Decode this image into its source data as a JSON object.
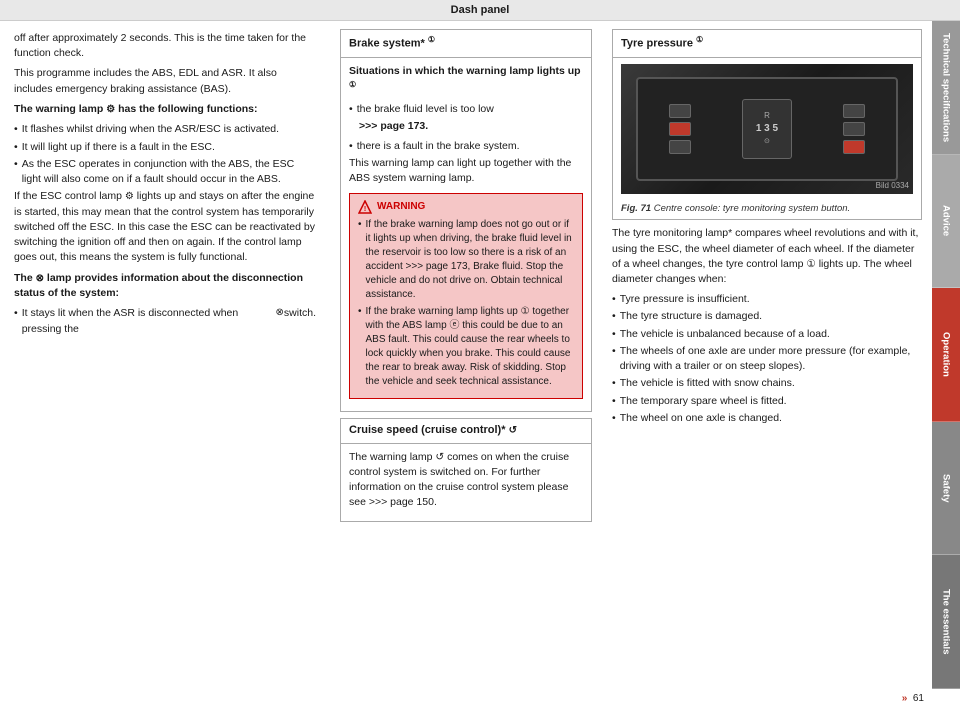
{
  "header": {
    "title": "Dash panel"
  },
  "left_column": {
    "intro_text": "off after approximately 2 seconds. This is the time taken for the function check.",
    "programme_text": "This programme includes the ABS, EDL and ASR. It also includes emergency braking assistance (BAS).",
    "warning_lamp_header": "The warning lamp",
    "warning_lamp_symbol": "⚙",
    "warning_lamp_suffix": " has the following functions:",
    "bullets": [
      "It flashes whilst driving when the ASR/ESC is activated.",
      "It will light up if there is a fault in the ESC.",
      "As the ESC operates in conjunction with the ABS, the ESC light will also come on if a fault should occur in the ABS."
    ],
    "esc_control_text": "If the ESC control lamp",
    "esc_control_symbol": "⚙",
    "esc_control_text2": "lights up and stays on after the engine is started, this may mean that the control system has temporarily switched off the ESC. In this case the ESC can be reactivated by switching the ignition off and then on again. If the control lamp goes out, this means the system is fully functional.",
    "lamp_provides_header": "The",
    "lamp_provides_symbol": "⊗",
    "lamp_provides_text": " lamp provides information about the disconnection status of the system:",
    "stays_lit_bullet": "It stays lit when the ASR is disconnected when pressing the",
    "stays_lit_symbol": "⊗",
    "stays_lit_suffix": " switch."
  },
  "middle_column": {
    "brake_system_header": "Brake system*",
    "brake_icon": "①",
    "situations_header": "Situations in which the warning lamp lights up",
    "situations_icon": "①",
    "bullet1": "the brake fluid level is too low",
    "page_ref1": ">>> page 173.",
    "bullet2": "there is a fault in the brake system.",
    "together_text": "This warning lamp can light up together with the ABS system warning lamp.",
    "warning_title": "WARNING",
    "warning_bullets": [
      "If the brake warning lamp does not go out or if it lights up when driving, the brake fluid level in the reservoir is too low so there is a risk of an accident >>> page 173, Brake fluid. Stop the vehicle and do not drive on. Obtain technical assistance.",
      "If the brake warning lamp lights up ① together with the ABS lamp ⓔ this could be due to an ABS fault. This could cause the rear wheels to lock quickly when you brake. This could cause the rear to break away. Risk of skidding. Stop the vehicle and seek technical assistance."
    ],
    "cruise_header": "Cruise speed (cruise control)*",
    "cruise_icon": "↺",
    "cruise_text": "The warning lamp ↺ comes on when the cruise control system is switched on. For further information on the cruise control system please see >>> page 150."
  },
  "right_column": {
    "tyre_header": "Tyre pressure",
    "tyre_icon": "①",
    "fig_number": "Fig. 71",
    "fig_caption": "Centre console: tyre monitoring system button.",
    "fig_ref": "Bild 0334",
    "intro_text": "The tyre monitoring lamp* compares wheel revolutions and with it, using the ESC, the wheel diameter of each wheel. If the diameter of a wheel changes, the tyre control lamp ① lights up. The wheel diameter changes when:",
    "bullets": [
      "Tyre pressure is insufficient.",
      "The tyre structure is damaged.",
      "The vehicle is unbalanced because of a load.",
      "The wheels of one axle are under more pressure (for example, driving with a trailer or on steep slopes).",
      "The vehicle is fitted with snow chains.",
      "The temporary spare wheel is fitted.",
      "The wheel on one axle is changed."
    ]
  },
  "sidebar": {
    "tabs": [
      {
        "label": "Technical specifications",
        "id": "tech"
      },
      {
        "label": "Advice",
        "id": "advice"
      },
      {
        "label": "Operation",
        "id": "operation"
      },
      {
        "label": "Safety",
        "id": "safety"
      },
      {
        "label": "The essentials",
        "id": "essentials"
      }
    ]
  },
  "footer": {
    "page_number": "61",
    "arrow": "»"
  }
}
